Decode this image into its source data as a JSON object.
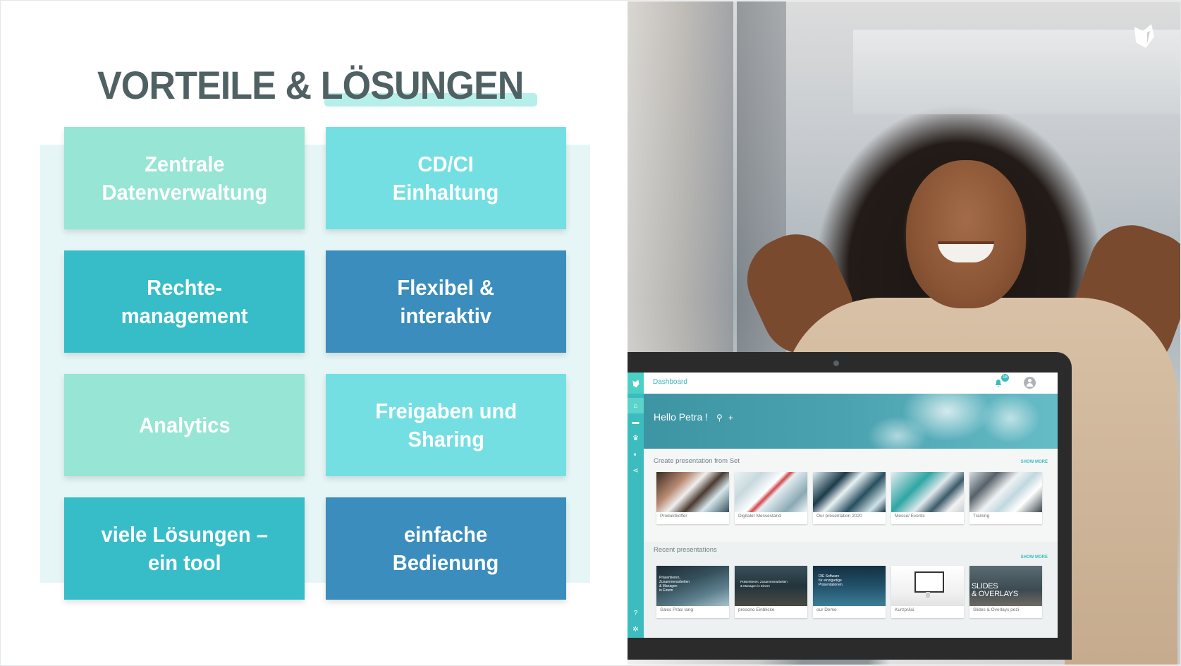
{
  "slide": {
    "title": "VORTEILE & LÖSUNGEN",
    "colors": {
      "title": "#4f6163",
      "title_highlight": "#b6efea",
      "panel_bg": "#e6f6f6",
      "mint": "#96e5d5",
      "light_cyan": "#74dfe2",
      "teal": "#37bdc8",
      "blue": "#3a8dbc"
    },
    "tiles": [
      {
        "label": "Zentrale\nDatenverwaltung",
        "color": "#96e5d5"
      },
      {
        "label": "CD/CI\nEinhaltung",
        "color": "#74dfe2"
      },
      {
        "label": "Rechte-\nmanagement",
        "color": "#37bdc8"
      },
      {
        "label": "Flexibel &\ninteraktiv",
        "color": "#3a8dbc"
      },
      {
        "label": "Analytics",
        "color": "#96e5d5"
      },
      {
        "label": "Freigaben und\nSharing",
        "color": "#74dfe2"
      },
      {
        "label": "viele Lösungen –\nein tool",
        "color": "#37bdc8"
      },
      {
        "label": "einfache\nBedienung",
        "color": "#3a8dbc"
      }
    ],
    "brand_logo_icon": "fox-logo-icon"
  },
  "app": {
    "breadcrumb": "Dashboard",
    "notification_count": "16",
    "greeting": "Hello Petra !",
    "banner_icons": [
      "search-icon",
      "plus-icon"
    ],
    "sidebar_icons": [
      "home-icon",
      "folder-icon",
      "trophy-icon",
      "pie-chart-icon",
      "share-icon",
      "help-icon",
      "gear-icon"
    ],
    "accent": "#3cbcbe",
    "sections": [
      {
        "title": "Create presentation from Set",
        "show_more": "SHOW MORE",
        "cards": [
          {
            "caption": "Produktkoffer"
          },
          {
            "caption": "Digitaler Messestand"
          },
          {
            "caption": "Our presentation 2020"
          },
          {
            "caption": "Messe/ Events"
          },
          {
            "caption": "Training"
          }
        ]
      },
      {
        "title": "Recent presentations",
        "show_more": "SHOW MORE",
        "cards": [
          {
            "caption": "Sales Präsi lang",
            "thumb_text": "Präsentieren,\nZusammenarbeiten\n& Managen\nin Einem"
          },
          {
            "caption": "presono Einblicke",
            "thumb_text": "Präsentieren, Zusammenarbeiten\n& Managen in Einem"
          },
          {
            "caption": "our Demo",
            "thumb_text": "DIE Software\nfür einzigartige\nPräsentationen."
          },
          {
            "caption": "Kurzpräsi"
          },
          {
            "caption": "Slides & Overlays pezi",
            "thumb_text": "SLIDES\n& OVERLAYS"
          }
        ]
      }
    ]
  }
}
